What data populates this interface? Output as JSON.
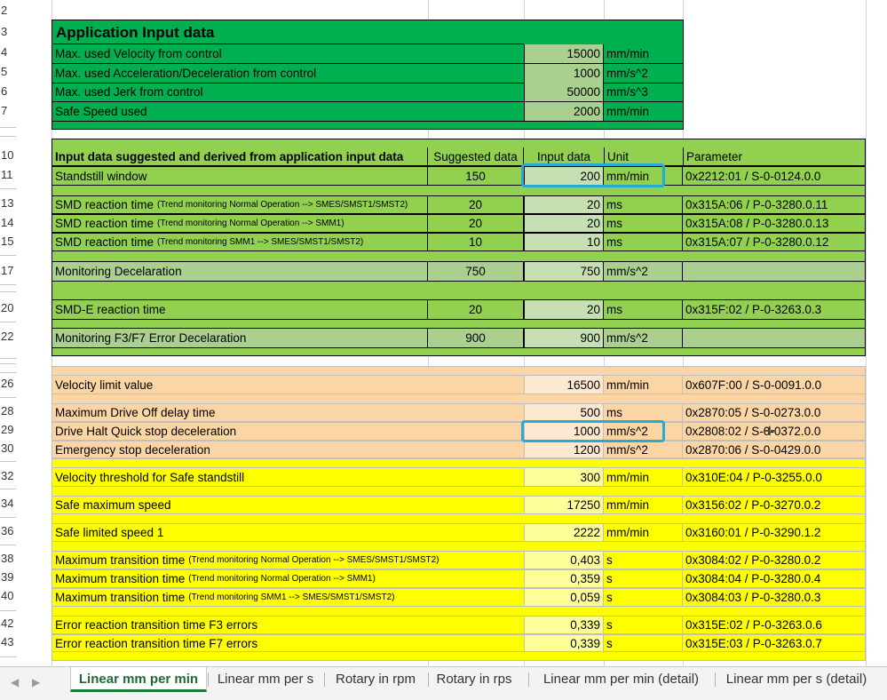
{
  "app_section": {
    "title": "Application Input data",
    "rows": [
      {
        "label": "Max. used Velocity from control",
        "value": "15000",
        "unit": "mm/min"
      },
      {
        "label": "Max. used Acceleration/Deceleration from control",
        "value": "1000",
        "unit": "mm/s^2"
      },
      {
        "label": "Max. used Jerk from control",
        "value": "50000",
        "unit": "mm/s^3"
      },
      {
        "label": "Safe Speed used",
        "value": "2000",
        "unit": "mm/min"
      }
    ]
  },
  "input_section": {
    "headers": {
      "title": "Input data suggested and derived from application input data",
      "suggested": "Suggested data",
      "input": "Input data",
      "unit": "Unit",
      "parameter": "Parameter"
    },
    "rows": [
      {
        "label": "Standstill window",
        "suffix": "",
        "suggested": "150",
        "input": "200",
        "unit": "mm/min",
        "param": "0x2212:01 / S-0-0124.0.0"
      },
      {
        "label": "SMD reaction time",
        "suffix": "(Trend monitoring Normal Operation --> SMES/SMST1/SMST2)",
        "suggested": "20",
        "input": "20",
        "unit": "ms",
        "param": "0x315A:06 / P-0-3280.0.11"
      },
      {
        "label": "SMD reaction time",
        "suffix": "(Trend monitoring Normal Operation --> SMM1)",
        "suggested": "20",
        "input": "20",
        "unit": "ms",
        "param": "0x315A:08 / P-0-3280.0.13"
      },
      {
        "label": "SMD reaction time",
        "suffix": "(Trend monitoring SMM1 --> SMES/SMST1/SMST2)",
        "suggested": "10",
        "input": "10",
        "unit": "ms",
        "param": "0x315A:07 / P-0-3280.0.12"
      },
      {
        "label": "Monitoring Decelaration",
        "suffix": "",
        "suggested": "750",
        "input": "750",
        "unit": "mm/s^2",
        "param": ""
      },
      {
        "label": "SMD-E reaction time",
        "suffix": "",
        "suggested": "20",
        "input": "20",
        "unit": "ms",
        "param": "0x315F:02 / P-0-3263.0.3"
      },
      {
        "label": "Monitoring F3/F7 Error Decelaration",
        "suffix": "",
        "suggested": "900",
        "input": "900",
        "unit": "mm/s^2",
        "param": ""
      }
    ]
  },
  "drive_section": {
    "rows": [
      {
        "label": "Velocity limit value",
        "value": "16500",
        "unit": "mm/min",
        "param": "0x607F:00 / S-0-0091.0.0"
      },
      {
        "label": "Maximum Drive Off delay time",
        "value": "500",
        "unit": "ms",
        "param": "0x2870:05 / S-0-0273.0.0"
      },
      {
        "label": "Drive Halt Quick stop deceleration",
        "value": "1000",
        "unit": "mm/s^2",
        "param": "0x2808:02 / S-0-0372.0.0"
      },
      {
        "label": "Emergency stop deceleration",
        "value": "1200",
        "unit": "mm/s^2",
        "param": "0x2870:06 / S-0-0429.0.0"
      }
    ]
  },
  "safety_section": {
    "rows": [
      {
        "label": "Velocity threshold for Safe standstill",
        "suffix": "",
        "value": "300",
        "unit": "mm/min",
        "param": "0x310E:04 / P-0-3255.0.0"
      },
      {
        "label": "Safe maximum speed",
        "suffix": "",
        "value": "17250",
        "unit": "mm/min",
        "param": "0x3156:02 / P-0-3270.0.2"
      },
      {
        "label": "Safe limited speed 1",
        "suffix": "",
        "value": "2222",
        "unit": "mm/min",
        "param": "0x3160:01 / P-0-3290.1.2"
      },
      {
        "label": "Maximum transition time",
        "suffix": "(Trend monitoring Normal Operation --> SMES/SMST1/SMST2)",
        "value": "0,403",
        "unit": "s",
        "param": "0x3084:02 / P-0-3280.0.2"
      },
      {
        "label": "Maximum transition time",
        "suffix": "(Trend monitoring Normal Operation --> SMM1)",
        "value": "0,359",
        "unit": "s",
        "param": "0x3084:04 / P-0-3280.0.4"
      },
      {
        "label": "Maximum transition time",
        "suffix": "(Trend monitoring SMM1 --> SMES/SMST1/SMST2)",
        "value": "0,059",
        "unit": "s",
        "param": "0x3084:03 / P-0-3280.0.3"
      },
      {
        "label": "Error reaction transition time F3 errors",
        "suffix": "",
        "value": "0,339",
        "unit": "s",
        "param": "0x315E:02 / P-0-3263.0.6"
      },
      {
        "label": "Error reaction transition time F7 errors",
        "suffix": "",
        "value": "0,339",
        "unit": "s",
        "param": "0x315E:03 / P-0-3263.0.7"
      }
    ]
  },
  "row_numbers": [
    "2",
    "3",
    "4",
    "5",
    "6",
    "7",
    "10",
    "11",
    "13",
    "14",
    "15",
    "17",
    "20",
    "22",
    "26",
    "28",
    "29",
    "30",
    "32",
    "34",
    "36",
    "38",
    "39",
    "40",
    "42",
    "43"
  ],
  "tabs": [
    {
      "label": "Linear mm per min",
      "active": true
    },
    {
      "label": "Linear mm per s",
      "active": false
    },
    {
      "label": "Rotary in rpm",
      "active": false
    },
    {
      "label": "Rotary in rps",
      "active": false
    },
    {
      "label": "Linear mm per min (detail)",
      "active": false
    },
    {
      "label": "Linear mm per s (detail)",
      "active": false
    }
  ],
  "colors": {
    "dark_green": "#00b050",
    "light_green": "#92d050",
    "peach": "#fcd5a4",
    "yellow": "#ffff00",
    "highlight": "#2aa9d9"
  }
}
